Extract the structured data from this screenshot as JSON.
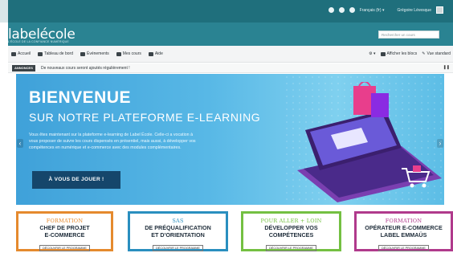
{
  "topbar": {
    "language": "Français (fr) ▾",
    "user": "Grégoire Lévesque"
  },
  "header": {
    "logo": "labelécole",
    "tagline": "L'ÉCOLE DE LA CONFIANCE NUMÉRIQUE",
    "search_placeholder": "Rechercher un cours"
  },
  "nav": {
    "items": [
      {
        "label": "Accueil",
        "icon": "home-icon"
      },
      {
        "label": "Tableau de bord",
        "icon": "dashboard-icon"
      },
      {
        "label": "Événements",
        "icon": "calendar-icon"
      },
      {
        "label": "Mes cours",
        "icon": "courses-icon"
      },
      {
        "label": "Aide",
        "icon": "help-icon"
      }
    ],
    "right": {
      "gear": "⚙ ▾",
      "blocks": "Afficher les blocs",
      "standard": "Vue standard"
    }
  },
  "announcement": {
    "badge": "ANNONCES",
    "text": "De nouveaux cours seront ajoutés régulièrement !",
    "pause": "❚❚"
  },
  "banner": {
    "title": "BIENVENUE",
    "subtitle": "SUR NOTRE PLATEFORME E-LEARNING",
    "body": "Vous êtes maintenant sur la plateforme e-learning de Label École. Celle-ci a vocation à vous proposer de suivre les cours dispensés en présentiel, mais aussi, à développer vos compétences en numérique et e-commerce avec des modules complémentaires.",
    "button": "À VOUS DE JOUER !"
  },
  "cards": [
    {
      "line1": "FORMATION",
      "line2": "CHEF DE PROJET",
      "line3": "E-COMMERCE",
      "button": "DÉCOUVRIR LE PROGRAMME",
      "color": "#e58a2e"
    },
    {
      "line1": "SAS",
      "line2": "DE PRÉQUALIFICATION",
      "line3": "ET D'ORIENTATION",
      "button": "DÉCOUVRIR LE PROGRAMME",
      "color": "#2a8fbf"
    },
    {
      "line1": "POUR ALLER + LOIN",
      "line2": "DÉVELOPPER VOS",
      "line3": "COMPÉTENCES",
      "button": "DÉCOUVRIR LE PROGRAMME",
      "color": "#74c042"
    },
    {
      "line1": "FORMATION",
      "line2": "OPÉRATEUR E-COMMERCE",
      "line3": "LABEL EMMAÜS",
      "button": "DÉCOUVRIR LE PROGRAMME",
      "color": "#b03a8c"
    }
  ]
}
